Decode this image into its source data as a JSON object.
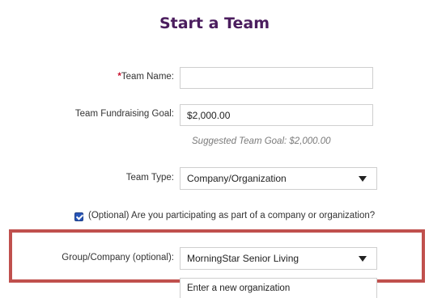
{
  "page": {
    "title": "Start a Team"
  },
  "form": {
    "team_name": {
      "required_marker": "*",
      "label": "Team Name:",
      "value": ""
    },
    "goal": {
      "label": "Team Fundraising Goal:",
      "value": "$2,000.00",
      "hint": "Suggested Team Goal: $2,000.00"
    },
    "team_type": {
      "label": "Team Type:",
      "selected": "Company/Organization"
    },
    "company_checkbox": {
      "checked": true,
      "label": "(Optional) Are you participating as part of a company or organization?"
    },
    "group_company": {
      "label": "Group/Company (optional):",
      "selected": "MorningStar Senior Living",
      "dropdown_option": "Enter a new organization"
    }
  },
  "colors": {
    "title": "#4b1d5e",
    "highlight_border": "#c0504d",
    "required": "#c8102e",
    "checkbox": "#2755b8"
  }
}
